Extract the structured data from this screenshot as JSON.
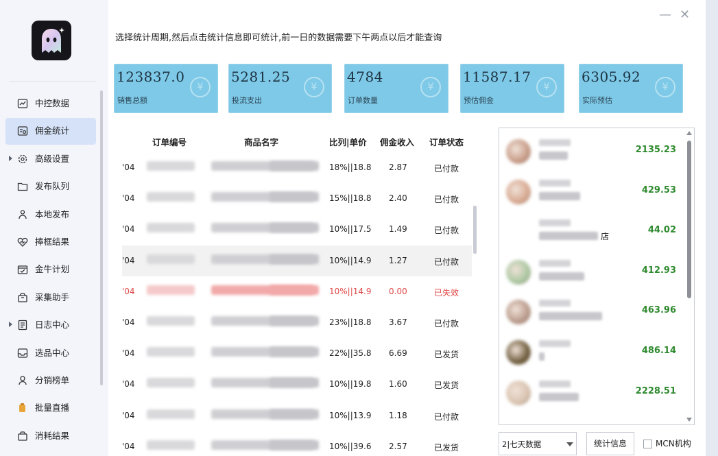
{
  "hint": "选择统计周期,然后点击统计信息即可统计,前一日的数据需要下午两点以后才能查询",
  "window": {
    "minimize": "—",
    "close": "✕"
  },
  "menu": [
    {
      "label": "中控数据",
      "icon": "chart-line-icon"
    },
    {
      "label": "佣金统计",
      "icon": "list-search-icon",
      "active": true
    },
    {
      "label": "高级设置",
      "icon": "gear-icon",
      "arrow": true
    },
    {
      "label": "发布队列",
      "icon": "folder-icon"
    },
    {
      "label": "本地发布",
      "icon": "person-upload-icon"
    },
    {
      "label": "捧框结果",
      "icon": "heart-pulse-icon"
    },
    {
      "label": "金牛计划",
      "icon": "calendar-check-icon"
    },
    {
      "label": "采集助手",
      "icon": "box-icon"
    },
    {
      "label": "日志中心",
      "icon": "log-document-icon",
      "arrow": true
    },
    {
      "label": "选品中心",
      "icon": "inbox-icon"
    },
    {
      "label": "分销榜单",
      "icon": "ranking-icon"
    },
    {
      "label": "批量直播",
      "icon": "live-icon"
    },
    {
      "label": "消耗结果",
      "icon": "result-box-icon"
    }
  ],
  "cards": [
    {
      "value": "123837.0",
      "label": "销售总额"
    },
    {
      "value": "5281.25",
      "label": "投流支出"
    },
    {
      "value": "4784",
      "label": "订单数量"
    },
    {
      "value": "11587.17",
      "label": "预估佣金"
    },
    {
      "value": "6305.92",
      "label": "实际预估"
    }
  ],
  "card_icon": "¥",
  "table": {
    "headers": [
      "订单编号",
      "商品名字",
      "比列|单价",
      "佣金收入",
      "订单状态"
    ],
    "rows": [
      {
        "prefix": "'04",
        "ratio": "18%||18.8",
        "income": "2.87",
        "status": "已付款"
      },
      {
        "prefix": "'04",
        "ratio": "15%||18.8",
        "income": "2.40",
        "status": "已付款"
      },
      {
        "prefix": "'04",
        "ratio": "10%||17.5",
        "income": "1.49",
        "status": "已付款"
      },
      {
        "prefix": "'04",
        "ratio": "10%||14.9",
        "income": "1.27",
        "status": "已付款",
        "highlight": true
      },
      {
        "prefix": "'04",
        "ratio": "10%||14.9",
        "income": "0.00",
        "status": "已失效",
        "invalid": true
      },
      {
        "prefix": "'04",
        "ratio": "23%||18.8",
        "income": "3.67",
        "status": "已付款"
      },
      {
        "prefix": "'04",
        "ratio": "22%||35.8",
        "income": "6.69",
        "status": "已发货"
      },
      {
        "prefix": "'04",
        "ratio": "10%||19.8",
        "income": "1.60",
        "status": "已发货"
      },
      {
        "prefix": "'04",
        "ratio": "10%||13.9",
        "income": "1.18",
        "status": "已付款"
      },
      {
        "prefix": "'04",
        "ratio": "10%||39.6",
        "income": "2.57",
        "status": "已发货"
      }
    ]
  },
  "accounts": [
    {
      "amount": "2135.23",
      "avatar_color": "#c79a86"
    },
    {
      "amount": "429.53",
      "avatar_color": "#d7a890"
    },
    {
      "amount": "44.02",
      "suffix": "店"
    },
    {
      "amount": "412.93",
      "avatar_color": "#a9c7a0"
    },
    {
      "amount": "463.96",
      "avatar_color": "#b8998a"
    },
    {
      "amount": "486.14",
      "avatar_color": "#6c5a3a"
    },
    {
      "amount": "2228.51",
      "avatar_color": "#d9c3b0"
    }
  ],
  "controls": {
    "period": "2|七天数据",
    "stat_button": "统计信息",
    "mcn_label": "MCN机构"
  }
}
